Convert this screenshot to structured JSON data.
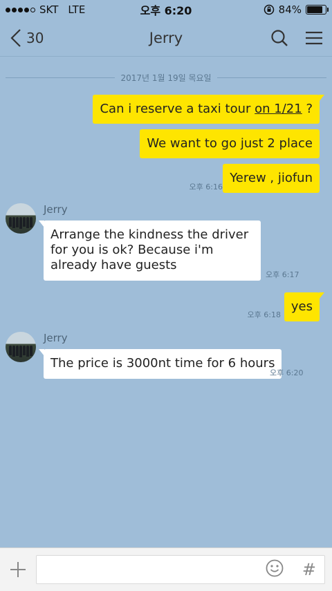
{
  "status_bar": {
    "carrier": "SKT",
    "network": "LTE",
    "time": "오후 6:20",
    "battery_text": "84%",
    "battery_level": 0.84
  },
  "header": {
    "back_count": "30",
    "title": "Jerry"
  },
  "chat": {
    "date": "2017년 1월 19일 목요일",
    "messages": [
      {
        "from": "me",
        "text_pre": "Can i reserve a taxi tour ",
        "text_link": "on 1/21",
        "text_post": " ?"
      },
      {
        "from": "me",
        "text": "We want to go just 2 place"
      },
      {
        "from": "me",
        "text": "Yerew , jiofun",
        "time": "오후 6:16"
      },
      {
        "from": "them",
        "sender": "Jerry",
        "text": "Arrange the kindness the driver for you is ok? Because i'm already have guests",
        "time": "오후 6:17"
      },
      {
        "from": "me",
        "text": "yes",
        "time": "오후 6:18"
      },
      {
        "from": "them",
        "sender": "Jerry",
        "text": "The price is 3000nt time for 6 hours",
        "time": "오후 6:20"
      }
    ]
  },
  "input": {
    "placeholder": "",
    "hash_label": "#"
  }
}
